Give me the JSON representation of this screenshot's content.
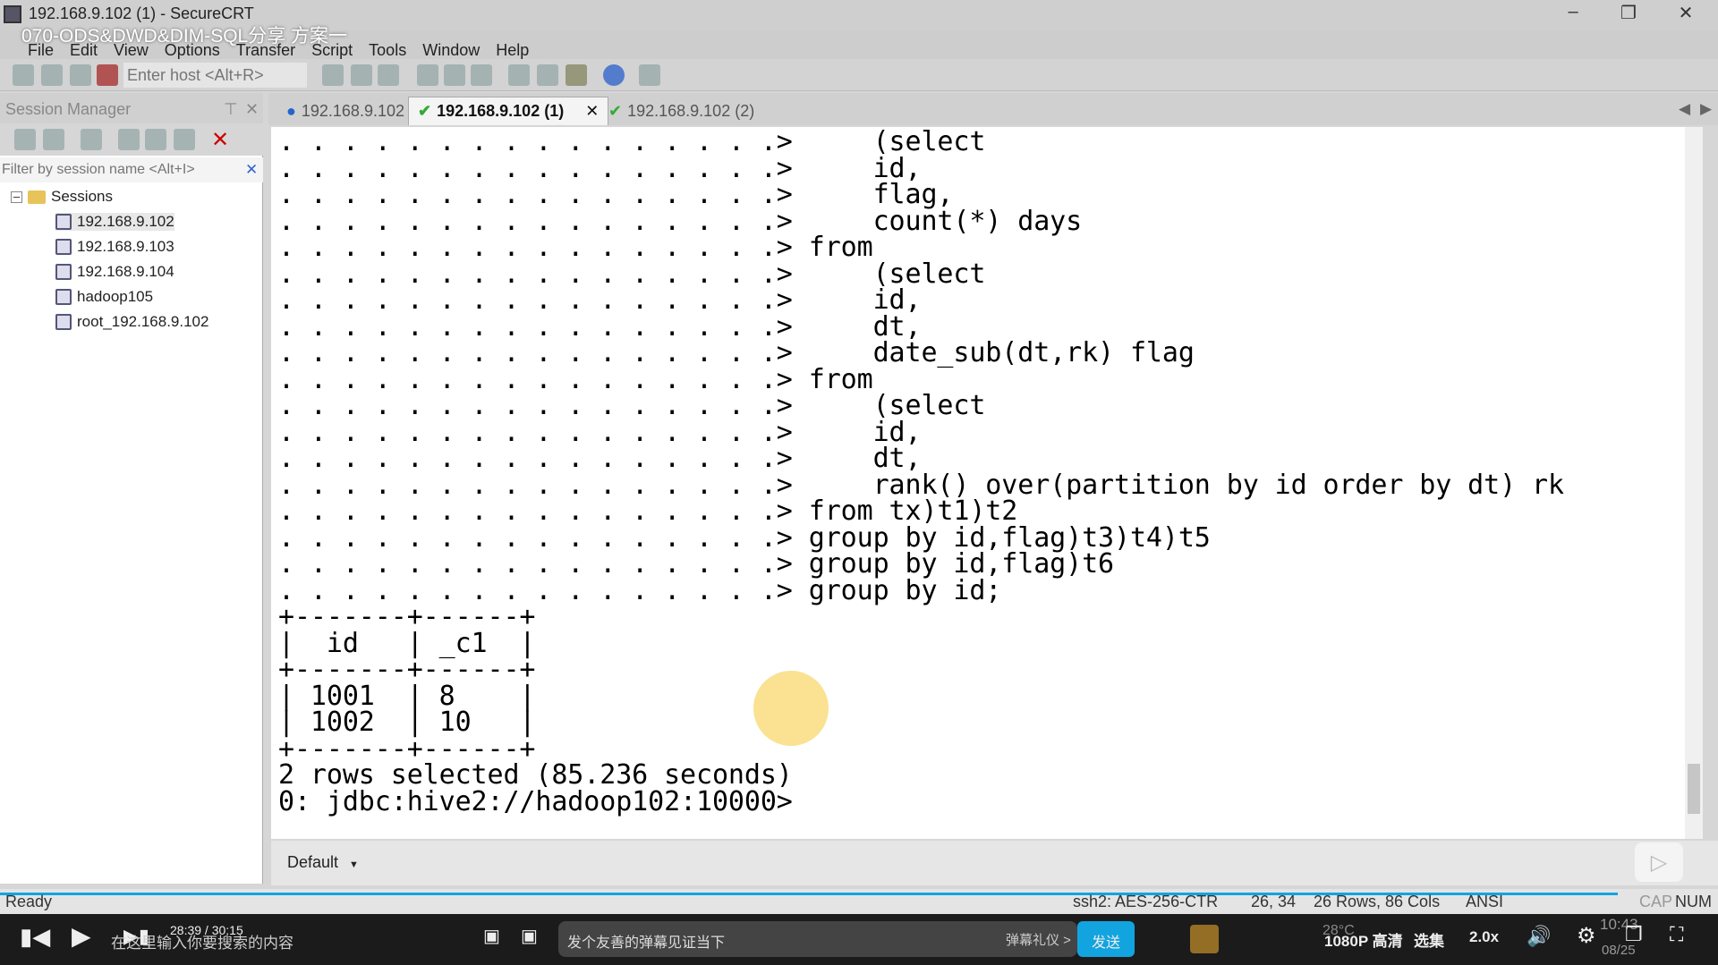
{
  "window": {
    "title": "192.168.9.102 (1) - SecureCRT",
    "video_overlay_title": "070-ODS&DWD&DIM-SQL分享 方案一"
  },
  "menu": [
    "File",
    "Edit",
    "View",
    "Options",
    "Transfer",
    "Script",
    "Tools",
    "Window",
    "Help"
  ],
  "toolbar": {
    "host_placeholder": "Enter host <Alt+R>"
  },
  "session_manager": {
    "title": "Session Manager",
    "filter_placeholder": "Filter by session name <Alt+I>",
    "root": "Sessions",
    "sessions": [
      "192.168.9.102",
      "192.168.9.103",
      "192.168.9.104",
      "hadoop105",
      "root_192.168.9.102"
    ]
  },
  "tabs": [
    {
      "label": "192.168.9.102",
      "status": "info"
    },
    {
      "label": "192.168.9.102 (1)",
      "status": "connected",
      "active": true
    },
    {
      "label": "192.168.9.102 (2)",
      "status": "connected"
    }
  ],
  "terminal": {
    "lines": [
      ". . . . . . . . . . . . . . . .>     (select",
      ". . . . . . . . . . . . . . . .>     id,",
      ". . . . . . . . . . . . . . . .>     flag,",
      ". . . . . . . . . . . . . . . .>     count(*) days",
      ". . . . . . . . . . . . . . . .> from",
      ". . . . . . . . . . . . . . . .>     (select",
      ". . . . . . . . . . . . . . . .>     id,",
      ". . . . . . . . . . . . . . . .>     dt,",
      ". . . . . . . . . . . . . . . .>     date_sub(dt,rk) flag",
      ". . . . . . . . . . . . . . . .> from",
      ". . . . . . . . . . . . . . . .>     (select",
      ". . . . . . . . . . . . . . . .>     id,",
      ". . . . . . . . . . . . . . . .>     dt,",
      ". . . . . . . . . . . . . . . .>     rank() over(partition by id order by dt) rk",
      ". . . . . . . . . . . . . . . .> from tx)t1)t2",
      ". . . . . . . . . . . . . . . .> group by id,flag)t3)t4)t5",
      ". . . . . . . . . . . . . . . .> group by id,flag)t6",
      ". . . . . . . . . . . . . . . .> group by id;",
      "+-------+------+",
      "|  id   | _c1  |",
      "+-------+------+",
      "| 1001  | 8    |",
      "| 1002  | 10   |",
      "+-------+------+",
      "2 rows selected (85.236 seconds)",
      "0: jdbc:hive2://hadoop102:10000>"
    ]
  },
  "bottom": {
    "default_select": "Default"
  },
  "status": {
    "ready": "Ready",
    "cipher": "ssh2: AES-256-CTR",
    "cursor_pos": "26,  34",
    "size": "26 Rows, 86 Cols",
    "encoding": "ANSI",
    "cap": "CAP",
    "num": "NUM"
  },
  "player": {
    "time": "28:39 / 30:15",
    "search_placeholder": "在这里输入你要搜索的内容",
    "danmaku_placeholder": "发个友善的弹幕见证当下",
    "danmaku_etiquette": "弹幕礼仪 >",
    "send": "发送",
    "quality": "1080P 高清",
    "episodes": "选集",
    "speed": "2.0x",
    "temp": "28°C",
    "clock": "10:43",
    "date": "08/25"
  },
  "colors": {
    "accent": "#12a4df",
    "terminal_bg": "#ffffff"
  }
}
